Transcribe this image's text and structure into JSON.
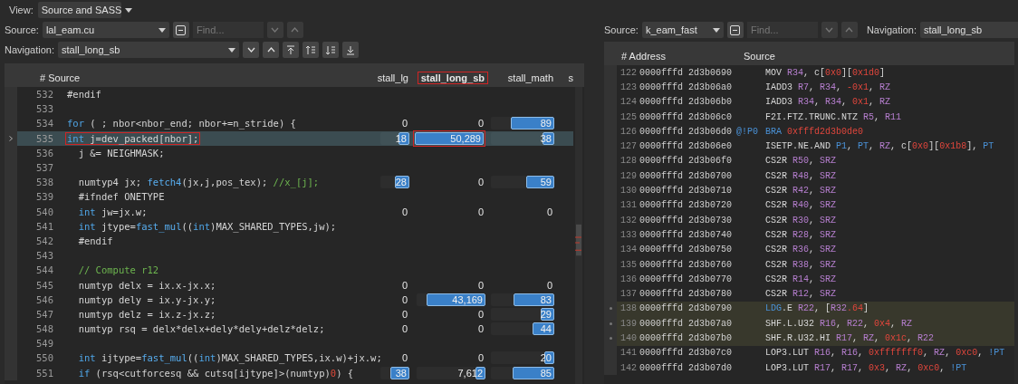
{
  "view": {
    "label": "View:",
    "value": "Source and SASS"
  },
  "left": {
    "source_label": "Source:",
    "source_value": "lal_eam.cu",
    "find_placeholder": "Find...",
    "navigation_label": "Navigation:",
    "navigation_value": "stall_long_sb",
    "source_header": "# Source",
    "metric_columns": [
      {
        "label": "stall_lg",
        "outlined": false
      },
      {
        "label": "stall_long_sb",
        "outlined": true
      },
      {
        "label": "stall_math",
        "outlined": false
      },
      {
        "label": "s",
        "outlined": false
      }
    ],
    "rows": [
      {
        "line": "532",
        "selected": false,
        "code": [
          {
            "text": "#endif",
            "kind": "plain"
          }
        ],
        "cells": []
      },
      {
        "line": "533",
        "selected": false,
        "code": [],
        "cells": []
      },
      {
        "line": "534",
        "selected": false,
        "code": [
          {
            "text": "for",
            "kind": "kw"
          },
          {
            "text": " ( ; nbor<nbor_end; nbor+=n_stride) {",
            "kind": "plain"
          }
        ],
        "cells": [
          {
            "value": "0"
          },
          {
            "value": "0"
          },
          {
            "value": "89",
            "level": 0.69
          }
        ]
      },
      {
        "line": "535",
        "selected": true,
        "outlined": true,
        "code": [
          {
            "text": "int",
            "kind": "kw"
          },
          {
            "text": " j=dev_packed[nbor];",
            "kind": "plain"
          }
        ],
        "cells": [
          {
            "value": "18",
            "level": 0.37
          },
          {
            "value": "50,289",
            "level": 1,
            "outlined": true
          },
          {
            "value": "38",
            "level": 0.19
          }
        ]
      },
      {
        "line": "536",
        "selected": false,
        "code": [
          {
            "text": "  j &= NEIGHMASK;",
            "kind": "plain"
          }
        ],
        "cells": []
      },
      {
        "line": "537",
        "selected": false,
        "code": [],
        "cells": []
      },
      {
        "line": "538",
        "selected": false,
        "code": [
          {
            "text": "  numtyp4 jx; ",
            "kind": "plain"
          },
          {
            "text": "fetch4",
            "kind": "fn"
          },
          {
            "text": "(jx,j,pos_tex); ",
            "kind": "plain"
          },
          {
            "text": "//x_[j];",
            "kind": "cm"
          }
        ],
        "cells": [
          {
            "value": "28",
            "level": 0.5
          },
          {
            "value": "0"
          },
          {
            "value": "59",
            "level": 0.45
          }
        ]
      },
      {
        "line": "539",
        "selected": false,
        "code": [
          {
            "text": "  #ifndef ONETYPE",
            "kind": "plain"
          }
        ],
        "cells": []
      },
      {
        "line": "540",
        "selected": false,
        "code": [
          {
            "text": "  int",
            "kind": "kw"
          },
          {
            "text": " jw=jx.w;",
            "kind": "plain"
          }
        ],
        "cells": [
          {
            "value": "0"
          },
          {
            "value": "0"
          },
          {
            "value": "0"
          }
        ]
      },
      {
        "line": "541",
        "selected": false,
        "code": [
          {
            "text": "  int",
            "kind": "kw"
          },
          {
            "text": " jtype=",
            "kind": "plain"
          },
          {
            "text": "fast_mul",
            "kind": "fn"
          },
          {
            "text": "((",
            "kind": "plain"
          },
          {
            "text": "int",
            "kind": "kw"
          },
          {
            "text": ")MAX_SHARED_TYPES,jw);",
            "kind": "plain"
          }
        ],
        "cells": []
      },
      {
        "line": "542",
        "selected": false,
        "code": [
          {
            "text": "  #endif",
            "kind": "plain"
          }
        ],
        "cells": []
      },
      {
        "line": "543",
        "selected": false,
        "code": [],
        "cells": []
      },
      {
        "line": "544",
        "selected": false,
        "code": [
          {
            "text": "  // Compute r12",
            "kind": "cm"
          }
        ],
        "cells": []
      },
      {
        "line": "545",
        "selected": false,
        "code": [
          {
            "text": "  numtyp delx = ix.x-jx.x;",
            "kind": "plain"
          }
        ],
        "cells": [
          {
            "value": "0"
          },
          {
            "value": "0"
          },
          {
            "value": "0"
          }
        ]
      },
      {
        "line": "546",
        "selected": false,
        "code": [
          {
            "text": "  numtyp dely = ix.y-jx.y;",
            "kind": "plain"
          }
        ],
        "cells": [
          {
            "value": "0"
          },
          {
            "value": "43,169",
            "level": 0.86
          },
          {
            "value": "83",
            "level": 0.64
          }
        ]
      },
      {
        "line": "547",
        "selected": false,
        "code": [
          {
            "text": "  numtyp delz = ix.z-jx.z;",
            "kind": "plain"
          }
        ],
        "cells": [
          {
            "value": "0"
          },
          {
            "value": "0"
          },
          {
            "value": "29",
            "level": 0.22
          }
        ]
      },
      {
        "line": "548",
        "selected": false,
        "code": [
          {
            "text": "  numtyp rsq = delx*delx+dely*dely+delz*delz;",
            "kind": "plain"
          }
        ],
        "cells": [
          {
            "value": "0"
          },
          {
            "value": "0"
          },
          {
            "value": "44",
            "level": 0.35
          }
        ]
      },
      {
        "line": "549",
        "selected": false,
        "code": [],
        "cells": []
      },
      {
        "line": "550",
        "selected": false,
        "code": [
          {
            "text": "  int",
            "kind": "kw"
          },
          {
            "text": " ijtype=",
            "kind": "plain"
          },
          {
            "text": "fast_mul",
            "kind": "fn"
          },
          {
            "text": "((",
            "kind": "plain"
          },
          {
            "text": "int",
            "kind": "kw"
          },
          {
            "text": ")MAX_SHARED_TYPES,ix.w)+jx.w;",
            "kind": "plain"
          }
        ],
        "cells": [
          {
            "value": "0"
          },
          {
            "value": "0"
          },
          {
            "value": "20",
            "level": 0.16
          }
        ]
      },
      {
        "line": "551",
        "selected": false,
        "code": [
          {
            "text": "  if",
            "kind": "kw"
          },
          {
            "text": " (rsq<cutforcesq && cutsq[ijtype]>(numtyp)",
            "kind": "plain"
          },
          {
            "text": "0",
            "kind": "num"
          },
          {
            "text": ") {",
            "kind": "plain"
          }
        ],
        "cells": [
          {
            "value": "38",
            "level": 0.66
          },
          {
            "value": "7,612",
            "level": 0.15
          },
          {
            "value": "85",
            "level": 0.66
          }
        ]
      }
    ]
  },
  "right": {
    "source_label": "Source:",
    "source_value": "k_eam_fast",
    "find_placeholder": "Find...",
    "navigation_label": "Navigation:",
    "navigation_value": "stall_long_sb",
    "columns": [
      {
        "label": "# Address"
      },
      {
        "label": "Source"
      }
    ],
    "rows": [
      {
        "line": "122",
        "address": "0000fffd 2d3b0690",
        "highlighted": false,
        "code": [
          {
            "text": "MOV ",
            "kind": "op"
          },
          {
            "text": "R34",
            "kind": "reg"
          },
          {
            "text": ", c[",
            "kind": "op"
          },
          {
            "text": "0x0",
            "kind": "imm"
          },
          {
            "text": "][",
            "kind": "op"
          },
          {
            "text": "0x1d0",
            "kind": "imm"
          },
          {
            "text": "]",
            "kind": "op"
          }
        ]
      },
      {
        "line": "123",
        "address": "0000fffd 2d3b06a0",
        "highlighted": false,
        "code": [
          {
            "text": "IADD3 ",
            "kind": "op"
          },
          {
            "text": "R7",
            "kind": "reg"
          },
          {
            "text": ", ",
            "kind": "op"
          },
          {
            "text": "R34",
            "kind": "reg"
          },
          {
            "text": ", ",
            "kind": "op"
          },
          {
            "text": "-0x1",
            "kind": "imm"
          },
          {
            "text": ", ",
            "kind": "op"
          },
          {
            "text": "RZ",
            "kind": "reg"
          }
        ]
      },
      {
        "line": "124",
        "address": "0000fffd 2d3b06b0",
        "highlighted": false,
        "code": [
          {
            "text": "IADD3 ",
            "kind": "op"
          },
          {
            "text": "R34",
            "kind": "reg"
          },
          {
            "text": ", ",
            "kind": "op"
          },
          {
            "text": "R34",
            "kind": "reg"
          },
          {
            "text": ", ",
            "kind": "op"
          },
          {
            "text": "0x1",
            "kind": "imm"
          },
          {
            "text": ", ",
            "kind": "op"
          },
          {
            "text": "RZ",
            "kind": "reg"
          }
        ]
      },
      {
        "line": "125",
        "address": "0000fffd 2d3b06c0",
        "highlighted": false,
        "code": [
          {
            "text": "F2I.FTZ.TRUNC.NTZ ",
            "kind": "op"
          },
          {
            "text": "R5",
            "kind": "reg"
          },
          {
            "text": ", ",
            "kind": "op"
          },
          {
            "text": "R11",
            "kind": "reg"
          }
        ]
      },
      {
        "line": "126",
        "address": "0000fffd 2d3b06d0",
        "predicate": "@!P0",
        "highlighted": false,
        "code": [
          {
            "text": "BRA ",
            "kind": "pred"
          },
          {
            "text": "0xfffd2d3b0de0",
            "kind": "imm"
          }
        ]
      },
      {
        "line": "127",
        "address": "0000fffd 2d3b06e0",
        "highlighted": false,
        "code": [
          {
            "text": "ISETP.NE.AND ",
            "kind": "op"
          },
          {
            "text": "P1",
            "kind": "pred"
          },
          {
            "text": ", ",
            "kind": "op"
          },
          {
            "text": "PT",
            "kind": "pred"
          },
          {
            "text": ", ",
            "kind": "op"
          },
          {
            "text": "RZ",
            "kind": "reg"
          },
          {
            "text": ", c[",
            "kind": "op"
          },
          {
            "text": "0x0",
            "kind": "imm"
          },
          {
            "text": "][",
            "kind": "op"
          },
          {
            "text": "0x1b8",
            "kind": "imm"
          },
          {
            "text": "], ",
            "kind": "op"
          },
          {
            "text": "PT",
            "kind": "pred"
          }
        ]
      },
      {
        "line": "128",
        "address": "0000fffd 2d3b06f0",
        "highlighted": false,
        "code": [
          {
            "text": "CS2R ",
            "kind": "op"
          },
          {
            "text": "R50",
            "kind": "reg"
          },
          {
            "text": ", ",
            "kind": "op"
          },
          {
            "text": "SRZ",
            "kind": "reg"
          }
        ]
      },
      {
        "line": "129",
        "address": "0000fffd 2d3b0700",
        "highlighted": false,
        "code": [
          {
            "text": "CS2R ",
            "kind": "op"
          },
          {
            "text": "R48",
            "kind": "reg"
          },
          {
            "text": ", ",
            "kind": "op"
          },
          {
            "text": "SRZ",
            "kind": "reg"
          }
        ]
      },
      {
        "line": "130",
        "address": "0000fffd 2d3b0710",
        "highlighted": false,
        "code": [
          {
            "text": "CS2R ",
            "kind": "op"
          },
          {
            "text": "R42",
            "kind": "reg"
          },
          {
            "text": ", ",
            "kind": "op"
          },
          {
            "text": "SRZ",
            "kind": "reg"
          }
        ]
      },
      {
        "line": "131",
        "address": "0000fffd 2d3b0720",
        "highlighted": false,
        "code": [
          {
            "text": "CS2R ",
            "kind": "op"
          },
          {
            "text": "R40",
            "kind": "reg"
          },
          {
            "text": ", ",
            "kind": "op"
          },
          {
            "text": "SRZ",
            "kind": "reg"
          }
        ]
      },
      {
        "line": "132",
        "address": "0000fffd 2d3b0730",
        "highlighted": false,
        "code": [
          {
            "text": "CS2R ",
            "kind": "op"
          },
          {
            "text": "R30",
            "kind": "reg"
          },
          {
            "text": ", ",
            "kind": "op"
          },
          {
            "text": "SRZ",
            "kind": "reg"
          }
        ]
      },
      {
        "line": "133",
        "address": "0000fffd 2d3b0740",
        "highlighted": false,
        "code": [
          {
            "text": "CS2R ",
            "kind": "op"
          },
          {
            "text": "R28",
            "kind": "reg"
          },
          {
            "text": ", ",
            "kind": "op"
          },
          {
            "text": "SRZ",
            "kind": "reg"
          }
        ]
      },
      {
        "line": "134",
        "address": "0000fffd 2d3b0750",
        "highlighted": false,
        "code": [
          {
            "text": "CS2R ",
            "kind": "op"
          },
          {
            "text": "R36",
            "kind": "reg"
          },
          {
            "text": ", ",
            "kind": "op"
          },
          {
            "text": "SRZ",
            "kind": "reg"
          }
        ]
      },
      {
        "line": "135",
        "address": "0000fffd 2d3b0760",
        "highlighted": false,
        "code": [
          {
            "text": "CS2R ",
            "kind": "op"
          },
          {
            "text": "R38",
            "kind": "reg"
          },
          {
            "text": ", ",
            "kind": "op"
          },
          {
            "text": "SRZ",
            "kind": "reg"
          }
        ]
      },
      {
        "line": "136",
        "address": "0000fffd 2d3b0770",
        "highlighted": false,
        "code": [
          {
            "text": "CS2R ",
            "kind": "op"
          },
          {
            "text": "R14",
            "kind": "reg"
          },
          {
            "text": ", ",
            "kind": "op"
          },
          {
            "text": "SRZ",
            "kind": "reg"
          }
        ]
      },
      {
        "line": "137",
        "address": "0000fffd 2d3b0780",
        "highlighted": false,
        "code": [
          {
            "text": "CS2R ",
            "kind": "op"
          },
          {
            "text": "R12",
            "kind": "reg"
          },
          {
            "text": ", ",
            "kind": "op"
          },
          {
            "text": "SRZ",
            "kind": "reg"
          }
        ]
      },
      {
        "line": "138",
        "address": "0000fffd 2d3b0790",
        "highlighted": true,
        "code": [
          {
            "text": "LDG",
            "kind": "pred"
          },
          {
            "text": ".E ",
            "kind": "op"
          },
          {
            "text": "R22",
            "kind": "reg"
          },
          {
            "text": ", [",
            "kind": "op"
          },
          {
            "text": "R32",
            "kind": "reg"
          },
          {
            "text": ".64",
            "kind": "imm"
          },
          {
            "text": "]",
            "kind": "op"
          }
        ]
      },
      {
        "line": "139",
        "address": "0000fffd 2d3b07a0",
        "highlighted": true,
        "code": [
          {
            "text": "SHF.L.U32 ",
            "kind": "op"
          },
          {
            "text": "R16",
            "kind": "reg"
          },
          {
            "text": ", ",
            "kind": "op"
          },
          {
            "text": "R22",
            "kind": "reg"
          },
          {
            "text": ", ",
            "kind": "op"
          },
          {
            "text": "0x4",
            "kind": "imm"
          },
          {
            "text": ", ",
            "kind": "op"
          },
          {
            "text": "RZ",
            "kind": "reg"
          }
        ]
      },
      {
        "line": "140",
        "address": "0000fffd 2d3b07b0",
        "highlighted": true,
        "code": [
          {
            "text": "SHF.R.U32.HI ",
            "kind": "op"
          },
          {
            "text": "R17",
            "kind": "reg"
          },
          {
            "text": ", ",
            "kind": "op"
          },
          {
            "text": "RZ",
            "kind": "reg"
          },
          {
            "text": ", ",
            "kind": "op"
          },
          {
            "text": "0x1c",
            "kind": "imm"
          },
          {
            "text": ", ",
            "kind": "op"
          },
          {
            "text": "R22",
            "kind": "reg"
          }
        ]
      },
      {
        "line": "141",
        "address": "0000fffd 2d3b07c0",
        "highlighted": false,
        "code": [
          {
            "text": "LOP3.LUT ",
            "kind": "op"
          },
          {
            "text": "R16",
            "kind": "reg"
          },
          {
            "text": ", ",
            "kind": "op"
          },
          {
            "text": "R16",
            "kind": "reg"
          },
          {
            "text": ", ",
            "kind": "op"
          },
          {
            "text": "0xfffffff0",
            "kind": "imm"
          },
          {
            "text": ", ",
            "kind": "op"
          },
          {
            "text": "RZ",
            "kind": "reg"
          },
          {
            "text": ", ",
            "kind": "op"
          },
          {
            "text": "0xc0",
            "kind": "imm"
          },
          {
            "text": ", ",
            "kind": "op"
          },
          {
            "text": "!PT",
            "kind": "pred"
          }
        ]
      },
      {
        "line": "142",
        "address": "0000fffd 2d3b07d0",
        "highlighted": false,
        "code": [
          {
            "text": "LOP3.LUT ",
            "kind": "op"
          },
          {
            "text": "R17",
            "kind": "reg"
          },
          {
            "text": ", ",
            "kind": "op"
          },
          {
            "text": "R17",
            "kind": "reg"
          },
          {
            "text": ", ",
            "kind": "op"
          },
          {
            "text": "0x3",
            "kind": "imm"
          },
          {
            "text": ", ",
            "kind": "op"
          },
          {
            "text": "RZ",
            "kind": "reg"
          },
          {
            "text": ", ",
            "kind": "op"
          },
          {
            "text": "0xc0",
            "kind": "imm"
          },
          {
            "text": ", ",
            "kind": "op"
          },
          {
            "text": "!PT",
            "kind": "pred"
          }
        ]
      }
    ]
  }
}
